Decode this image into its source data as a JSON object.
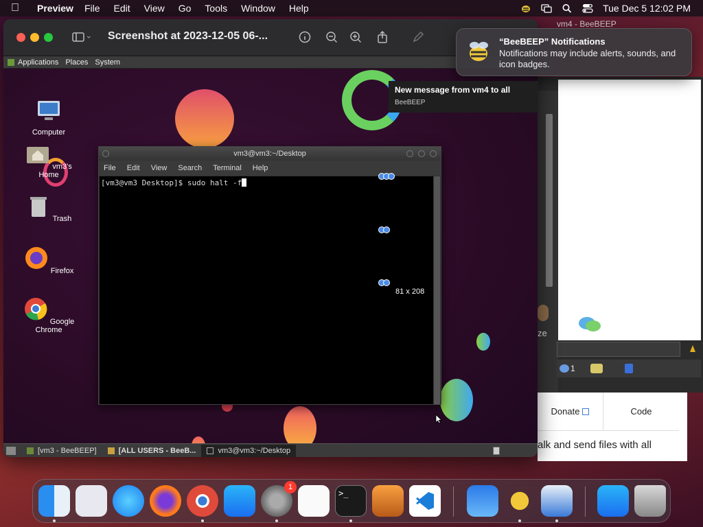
{
  "menubar": {
    "app_name": "Preview",
    "items": [
      "File",
      "Edit",
      "View",
      "Go",
      "Tools",
      "Window",
      "Help"
    ],
    "clock": "Tue Dec 5  12:02 PM"
  },
  "preview": {
    "title": "Screenshot at 2023-12-05 06-..."
  },
  "guest": {
    "topbar": [
      "Applications",
      "Places",
      "System"
    ],
    "desktop_icons": [
      "Computer",
      "vm3's Home",
      "Trash",
      "Firefox",
      "Google Chrome"
    ],
    "terminal": {
      "title": "vm3@vm3:~/Desktop",
      "menu": [
        "File",
        "Edit",
        "View",
        "Search",
        "Terminal",
        "Help"
      ],
      "prompt": "[vm3@vm3 Desktop]$ sudo halt -f"
    },
    "size_label": "81 x 208",
    "taskbar": [
      "[vm3 - BeeBEEP]",
      "[ALL USERS - BeeB...",
      "vm3@vm3:~/Desktop"
    ]
  },
  "notification": {
    "title": "“BeeBEEP” Notifications",
    "body": "Notifications may include alerts, sounds, and icon badges."
  },
  "toast": {
    "title": "New message from vm4 to all",
    "app": "BeeBEEP"
  },
  "background_window": {
    "title": "vm4 - BeeBEEP",
    "user_count": "1",
    "partial_label": "ze"
  },
  "browser": {
    "tabs": [
      "Donate",
      "Code"
    ],
    "text": "alk and send files with all"
  },
  "dock": {
    "apps": [
      "Finder",
      "Launchpad",
      "Safari",
      "Firefox",
      "Chrome",
      "App Store",
      "System Settings",
      "TextEdit",
      "Terminal",
      "GarageBand",
      "VS Code",
      "Weather",
      "BeeBEEP",
      "Preview",
      "App Store Downloads",
      "Trash"
    ],
    "settings_badge": "1"
  }
}
